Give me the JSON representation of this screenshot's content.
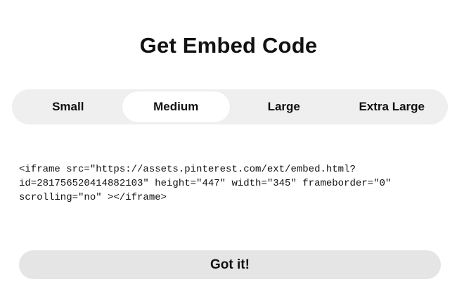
{
  "dialog": {
    "title": "Get Embed Code"
  },
  "size_tabs": {
    "selected": "Medium",
    "items": [
      {
        "label": "Small"
      },
      {
        "label": "Medium"
      },
      {
        "label": "Large"
      },
      {
        "label": "Extra Large"
      }
    ]
  },
  "embed": {
    "code": "<iframe src=\"https://assets.pinterest.com/ext/embed.html?\nid=281756520414882103\" height=\"447\" width=\"345\" frameborder=\"0\"\nscrolling=\"no\" ></iframe>"
  },
  "actions": {
    "confirm_label": "Got it!"
  },
  "colors": {
    "background": "#ffffff",
    "tab_track": "#efefef",
    "tab_selected": "#ffffff",
    "button_bg": "#e5e5e5",
    "text": "#111111"
  }
}
